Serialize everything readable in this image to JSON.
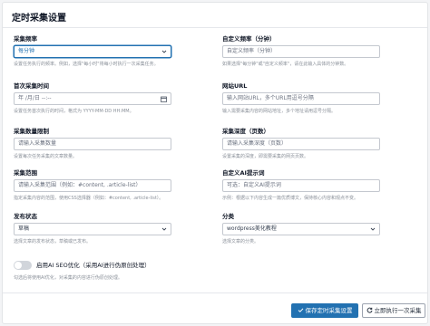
{
  "title": "定时采集设置",
  "fields": {
    "interval": {
      "label": "采集频率",
      "value": "每分钟",
      "help": "设置任务执行的频率。例如，选择\"每小时\"将每小时执行一次采集任务。"
    },
    "custom_interval": {
      "label": "自定义频率（分钟）",
      "placeholder": "自定义频率（分钟）",
      "help": "如果选择\"每分钟\"或\"自定义频率\"，请在此输入具体的分钟数。"
    },
    "first_run": {
      "label": "首次采集时间",
      "placeholder": "年 /月/日 --:--",
      "help": "设置任务首次执行的时间，格式为 YYYY-MM-DD HH:MM。"
    },
    "url": {
      "label": "网站URL",
      "placeholder": "输入网站URL，多个URL用逗号分隔",
      "help": "输入需要采集内容的网站地址，多个地址请用逗号分隔。"
    },
    "count": {
      "label": "采集数量限制",
      "placeholder": "请输入采集数量",
      "help": "设置每次任务采集的文章数量。"
    },
    "depth": {
      "label": "采集深度（页数）",
      "placeholder": "请输入采集深度（页数）",
      "help": "设置采集的深度，即需要采集的网页页数。"
    },
    "scope": {
      "label": "采集范围",
      "placeholder": "请输入采集范围（例如：#content, .article-list）",
      "help": "指定采集内容的范围，使用CSS选择器（例如：#content, .article-list）。"
    },
    "ai_prompt": {
      "label": "自定义AI提示词",
      "placeholder": "可选：自定义AI提示词",
      "help": "示例：根据以下内容生成一篇优质博文，保持核心内容和观点不变。"
    },
    "status": {
      "label": "发布状态",
      "value": "草稿",
      "help": "选择文章的发布状态，草稿或已发布。"
    },
    "category": {
      "label": "分类",
      "value": "wordpress美化教程",
      "help": "选择文章的分类。"
    }
  },
  "ai_seo": {
    "label": "启用AI SEO优化（采用AI进行伪原创处理）",
    "help": "勾选后将使用AI优化，对采集的内容进行伪原创处理。",
    "enabled": false
  },
  "buttons": {
    "save": "保存定时采集设置",
    "run": "立即执行一次采集"
  },
  "colors": {
    "primary": "#2271b1",
    "toggle_off": "#d1d5db"
  }
}
